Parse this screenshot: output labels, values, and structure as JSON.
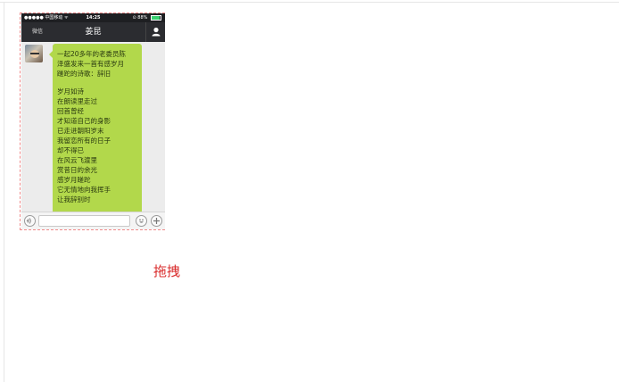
{
  "status_bar": {
    "carrier": "●●●●● 中国移动 ᯤ",
    "time": "14:25",
    "battery_text": "⊙ 88%",
    "battery_level": 0.88
  },
  "nav": {
    "back_label": "微信",
    "title": "姜昆",
    "profile_icon": "person-icon"
  },
  "message": {
    "lines": [
      "一起20多年的老委员陈",
      "泽盛发来一首有感岁月",
      "蹉跎的诗歌：辞旧",
      "",
      "岁月如诗",
      "在朗读里走过",
      "回首曾经",
      "才知道自己的身影",
      "已走进朝阳岁末",
      "我留恋所有的日子",
      "却不得已",
      "在风云飞渡里",
      "赏昔日的余光",
      "感岁月蹉跎",
      "它无情地向我挥手",
      "让我辞别时"
    ]
  },
  "input_bar": {
    "voice_icon": "voice-icon",
    "input_value": "",
    "emoji_icon": "emoji-icon",
    "plus_icon": "plus-icon"
  },
  "drag_label": "拖拽",
  "colors": {
    "bubble": "#b2d84b",
    "nav_bar": "#2b2c30",
    "frame": "#f08a8a",
    "drag_label": "#d92b2b"
  }
}
